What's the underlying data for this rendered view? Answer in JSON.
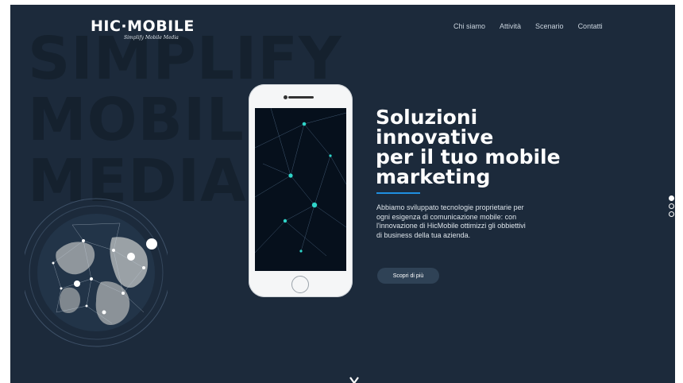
{
  "brand": {
    "name": "HIC·MOBILE",
    "tagline": "Simplify Mobile Media"
  },
  "nav": {
    "items": [
      "Chi siamo",
      "Attività",
      "Scenario",
      "Contatti"
    ]
  },
  "background_words": [
    "SIMPLIFY",
    "MOBILE",
    "MEDIA"
  ],
  "hero": {
    "headline_lines": [
      "Soluzioni",
      "innovative",
      "per il tuo mobile",
      "marketing"
    ],
    "description_lines": [
      "Abbiamo sviluppato tecnologie proprietarie per",
      "ogni esigenza di comunicazione mobile: con",
      "l'innovazione di HicMobile ottimizzi gli obbiettivi",
      "di business della tua azienda."
    ],
    "cta_label": "Scopri di più"
  },
  "slider": {
    "total": 3,
    "active": 1
  },
  "colors": {
    "background": "#1c2a3b",
    "accent": "#1f8fe0",
    "button": "#2f4256",
    "text": "#ffffff"
  },
  "icons": {
    "scroll": "chevron-down-icon"
  }
}
